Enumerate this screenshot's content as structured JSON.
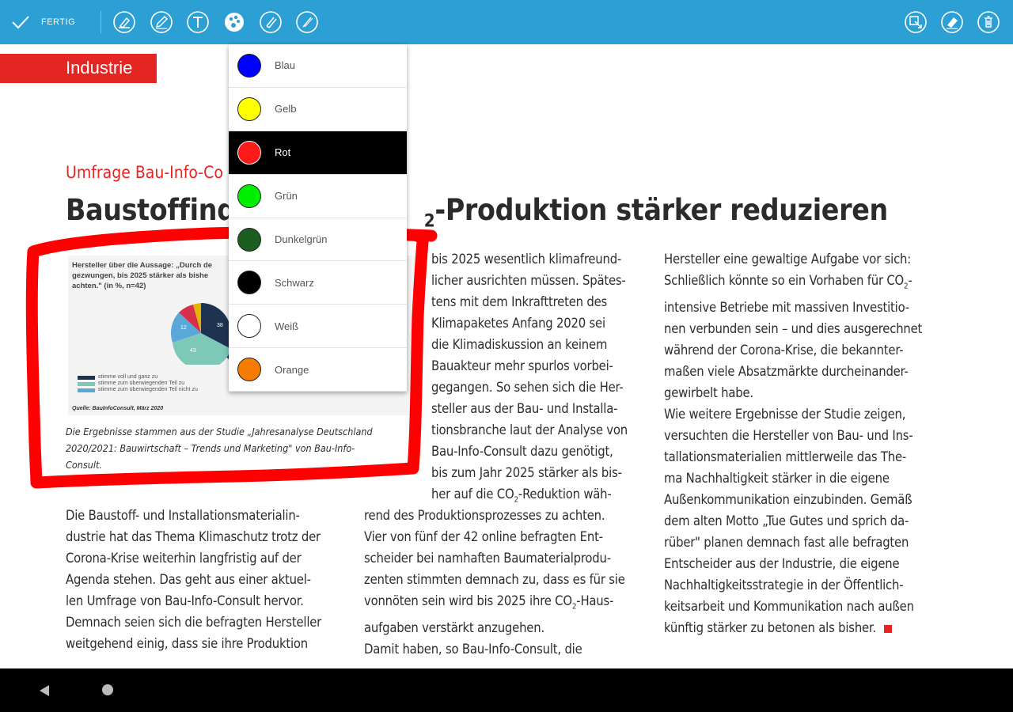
{
  "toolbar": {
    "done_label": "FERTIG",
    "tools": [
      "highlighter-icon",
      "pen-icon",
      "text-icon",
      "color-palette-icon",
      "marker-icon",
      "pencil-icon"
    ],
    "right_tools": [
      "select-annotation-icon",
      "eraser-icon",
      "delete-icon"
    ]
  },
  "article": {
    "section": "Industrie",
    "kicker": "Umfrage Bau-Info-Co",
    "headline_pre": "Baustoffind",
    "headline_sub": "2",
    "headline_post": "-Produktion stärker reduzieren",
    "chart": {
      "question_lines": [
        "Hersteller über die Aussage: „Durch de",
        "gezwungen, bis 2025 stärker als bishe",
        "achten.\" (in %, n=42)"
      ],
      "legend": [
        "stimme voll und ganz zu",
        "stimme zum überwiegenden Teil zu",
        "stimme zum überwiegenden Teil nicht zu"
      ],
      "source": "Quelle: BauInfoConsult, März 2020",
      "slice_labels": [
        "43",
        "12",
        "38"
      ]
    },
    "caption_lines": [
      "Die Ergebnisse stammen aus der Studie „Jahresanalyse Deutschland",
      "2020/2021: Bauwirtschaft – Trends und Marketing\" von Bau-Info-",
      "Consult."
    ],
    "col1_lines": [
      "Die Baustoff- und Installationsmaterialin-",
      "dustrie hat das Thema Klimaschutz trotz der",
      "Corona-Krise weiterhin langfristig auf der",
      "Agenda stehen. Das geht aus einer aktuel-",
      "len Umfrage von Bau-Info-Consult hervor.",
      "Demnach seien sich die befragten Hersteller",
      "weitgehend einig, dass sie ihre Produktion"
    ],
    "col2_top_lines": [
      "bis 2025 wesentlich klimafreund-",
      "licher ausrichten müssen. Spätes-",
      "tens mit dem Inkrafttreten des",
      "Klimapaketes Anfang 2020 sei",
      "die Klimadiskussion an keinem",
      "Bauakteur mehr spurlos vorbei-",
      "gegangen. So sehen sich die Her-",
      "steller aus der Bau- und Installa-",
      "tionsbranche laut der Analyse von",
      "Bau-Info-Consult dazu genötigt,",
      "bis zum Jahr 2025 stärker als bis-"
    ],
    "col2_co2_a_pre": "her auf die CO",
    "col2_co2_a_post": "-Reduktion wäh-",
    "col2_mid_lines": [
      "rend des Produktionsprozesses zu achten.",
      "Vier von fünf der 42 online befragten Ent-",
      "scheider bei namhaften Baumaterialprodu-",
      "zenten stimmten demnach zu, dass es für sie"
    ],
    "col2_co2_b_pre": "vonnöten sein wird bis 2025 ihre CO",
    "col2_co2_b_post": "-Haus-",
    "col2_end_lines": [
      "aufgaben verstärkt anzugehen.",
      "Damit haben, so Bau-Info-Consult, die"
    ],
    "col3_first": "Hersteller eine gewaltige Aufgabe vor sich:",
    "col3_co2_pre": "Schließlich könnte so ein Vorhaben für CO",
    "col3_co2_post": "-",
    "col3_lines": [
      "intensive Betriebe mit massiven Investitio-",
      "nen verbunden sein – und dies ausgerechnet",
      "während der Corona-Krise, die bekannter-",
      "maßen viele Absatzmärkte durcheinander-",
      "gewirbelt habe.",
      "Wie weitere Ergebnisse der Studie zeigen,",
      "versuchten die Hersteller von Bau- und Ins-",
      "tallationsmaterialien mittlerweile das The-",
      "ma Nachhaltigkeit stärker in die eigene",
      "Außenkommunikation einzubinden. Gemäß",
      "dem alten Motto „Tue Gutes und sprich da-",
      "rüber\" planen demnach fast alle befragten",
      "Entscheider aus der Industrie, die eigene",
      "Nachhaltigkeitsstrategie in der Öffentlich-",
      "keitsarbeit und Kommunikation nach außen"
    ],
    "col3_last": "künftig stärker zu betonen als bisher."
  },
  "color_menu": {
    "selected": "Rot",
    "items": [
      {
        "label": "Blau",
        "color": "#0000ff"
      },
      {
        "label": "Gelb",
        "color": "#ffff00"
      },
      {
        "label": "Rot",
        "color": "#ff1a1a"
      },
      {
        "label": "Grün",
        "color": "#00ee00"
      },
      {
        "label": "Dunkelgrün",
        "color": "#1b5e20"
      },
      {
        "label": "Schwarz",
        "color": "#000000"
      },
      {
        "label": "Weiß",
        "color": "#ffffff"
      },
      {
        "label": "Orange",
        "color": "#f57c00"
      }
    ]
  },
  "annotation": {
    "stroke_color": "#ff0000"
  },
  "colors": {
    "toolbar": "#2c9fd5",
    "accent": "#e52521"
  }
}
